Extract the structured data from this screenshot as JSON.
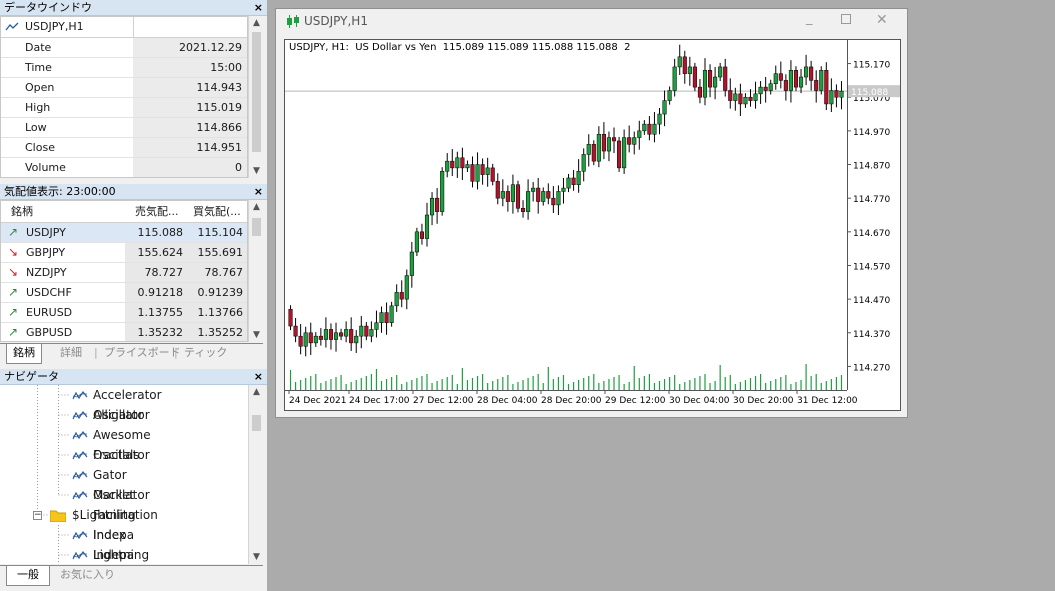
{
  "data_window": {
    "title": "データウインドウ",
    "close_label": "×",
    "symbol": "USDJPY,H1",
    "rows": [
      {
        "label": "Date",
        "value": "2021.12.29"
      },
      {
        "label": "Time",
        "value": "15:00"
      },
      {
        "label": "Open",
        "value": "114.943"
      },
      {
        "label": "High",
        "value": "115.019"
      },
      {
        "label": "Low",
        "value": "114.866"
      },
      {
        "label": "Close",
        "value": "114.951"
      },
      {
        "label": "Volume",
        "value": "0"
      }
    ]
  },
  "market_watch": {
    "title": "気配値表示: 23:00:00",
    "close_label": "×",
    "headers": {
      "symbol": "銘柄",
      "bid": "売気配...",
      "ask": "買気配(..."
    },
    "rows": [
      {
        "symbol": "USDJPY",
        "bid": "115.088",
        "ask": "115.104",
        "direction": "up"
      },
      {
        "symbol": "GBPJPY",
        "bid": "155.624",
        "ask": "155.691",
        "direction": "down"
      },
      {
        "symbol": "NZDJPY",
        "bid": "78.727",
        "ask": "78.767",
        "direction": "down"
      },
      {
        "symbol": "USDCHF",
        "bid": "0.91218",
        "ask": "0.91239",
        "direction": "up"
      },
      {
        "symbol": "EURUSD",
        "bid": "1.13755",
        "ask": "1.13766",
        "direction": "up"
      },
      {
        "symbol": "GBPUSD",
        "bid": "1.35232",
        "ask": "1.35252",
        "direction": "up"
      }
    ],
    "tabs": [
      "銘柄",
      "詳細",
      "プライスボード",
      "ティック"
    ],
    "colors": {
      "up": "#2a8a3a",
      "down": "#c0282d"
    }
  },
  "navigator": {
    "title": "ナビゲータ",
    "close_label": "×",
    "items": [
      {
        "label": "Accelerator Oscillator",
        "icon": "indicator-icon"
      },
      {
        "label": "Alligator",
        "icon": "indicator-icon"
      },
      {
        "label": "Awesome Oscillator",
        "icon": "indicator-icon"
      },
      {
        "label": "Fractals",
        "icon": "indicator-icon"
      },
      {
        "label": "Gator Oscillator",
        "icon": "indicator-icon"
      },
      {
        "label": "Market Facilitation Index",
        "icon": "indicator-icon"
      },
      {
        "label": "$Lightning",
        "icon": "folder-icon"
      },
      {
        "label": "Indepa Lightning EN",
        "icon": "indicator-icon"
      },
      {
        "label": "Indepa Lightning JP",
        "icon": "indicator-icon"
      }
    ],
    "tabs": [
      "一般",
      "お気に入り"
    ]
  },
  "chart_window": {
    "title": "USDJPY,H1",
    "info": "USDJPY, H1:  US Dollar vs Yen  115.089 115.089 115.088 115.088  2",
    "bid_label": "115.088",
    "colors": {
      "bull": "#1e9e3e",
      "bear": "#b0142b",
      "volume": "#1e9e3e"
    }
  },
  "chart_data": {
    "type": "candlestick",
    "symbol": "USDJPY",
    "timeframe": "H1",
    "ylim": [
      114.2,
      115.24
    ],
    "yticks": [
      "115.170",
      "115.070",
      "114.970",
      "114.870",
      "114.770",
      "114.670",
      "114.570",
      "114.470",
      "114.370",
      "114.270"
    ],
    "xticks": [
      "24 Dec 2021",
      "24 Dec 17:00",
      "27 Dec 12:00",
      "28 Dec 04:00",
      "28 Dec 20:00",
      "29 Dec 12:00",
      "30 Dec 04:00",
      "30 Dec 20:00",
      "31 Dec 12:00"
    ],
    "current_bid": 115.088,
    "close": [
      114.39,
      114.36,
      114.33,
      114.37,
      114.34,
      114.36,
      114.35,
      114.38,
      114.35,
      114.37,
      114.36,
      114.38,
      114.34,
      114.36,
      114.39,
      114.36,
      114.38,
      114.4,
      114.43,
      114.4,
      114.45,
      114.49,
      114.47,
      114.54,
      114.61,
      114.67,
      114.65,
      114.72,
      114.77,
      114.73,
      114.85,
      114.88,
      114.86,
      114.89,
      114.86,
      114.87,
      114.82,
      114.87,
      114.84,
      114.86,
      114.82,
      114.77,
      114.79,
      114.76,
      114.81,
      114.74,
      114.73,
      114.79,
      114.8,
      114.76,
      114.79,
      114.77,
      114.75,
      114.79,
      114.8,
      114.83,
      114.81,
      114.85,
      114.9,
      114.93,
      114.88,
      114.96,
      114.91,
      114.95,
      114.94,
      114.86,
      114.95,
      114.93,
      114.95,
      114.97,
      114.99,
      114.96,
      114.99,
      115.02,
      115.06,
      115.09,
      115.16,
      115.19,
      115.14,
      115.16,
      115.1,
      115.07,
      115.15,
      115.1,
      115.13,
      115.16,
      115.09,
      115.06,
      115.08,
      115.05,
      115.07,
      115.06,
      115.08,
      115.1,
      115.09,
      115.11,
      115.14,
      115.12,
      115.09,
      115.15,
      115.1,
      115.13,
      115.16,
      115.12,
      115.09,
      115.15,
      115.05,
      115.09,
      115.07,
      115.088
    ]
  }
}
